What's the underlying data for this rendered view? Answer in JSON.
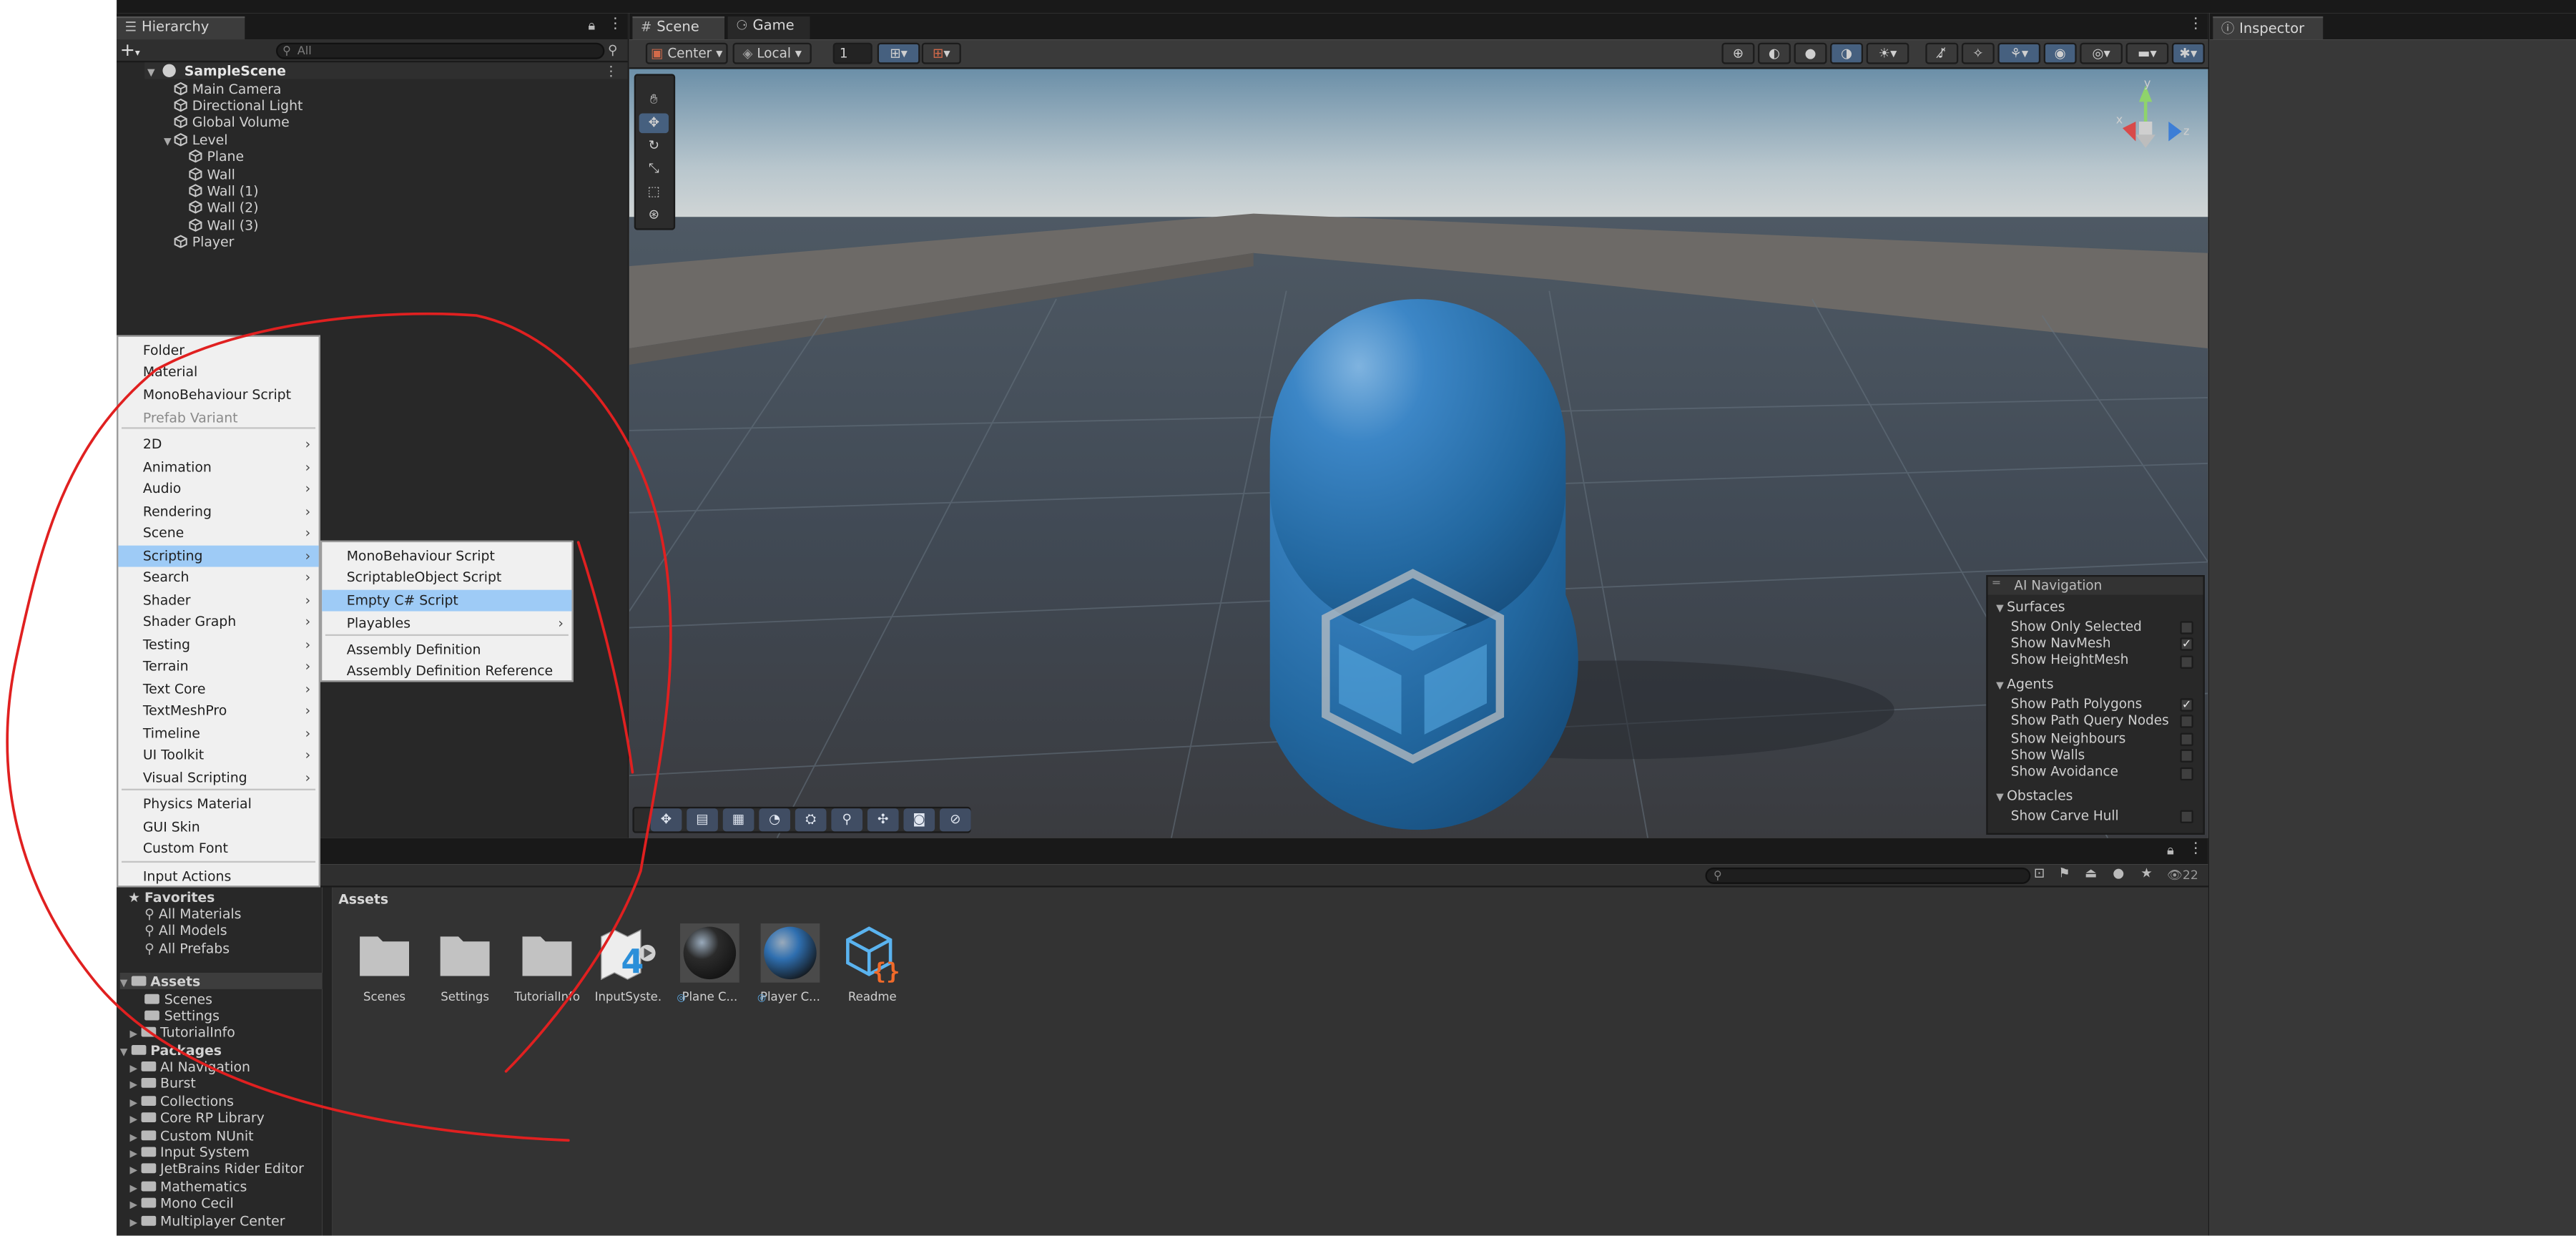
{
  "hierarchy": {
    "tab_label": "Hierarchy",
    "search_placeholder": "All",
    "scene_name": "SampleScene",
    "items": [
      "Main Camera",
      "Directional Light",
      "Global Volume",
      "Level",
      "Plane",
      "Wall",
      "Wall (1)",
      "Wall (2)",
      "Wall (3)",
      "Player"
    ]
  },
  "scene_tabs": {
    "scene": "Scene",
    "game": "Game"
  },
  "scene_toolbar": {
    "pivot": "Center",
    "space": "Local",
    "grid_value": "1"
  },
  "inspector": {
    "tab_label": "Inspector"
  },
  "gizmo_axes": {
    "y": "y",
    "x": "x",
    "z": "z"
  },
  "create_menu": {
    "items": [
      {
        "label": "Folder"
      },
      {
        "label": "Material"
      },
      {
        "label": "MonoBehaviour Script"
      },
      {
        "label": "Prefab Variant",
        "disabled": true
      },
      {
        "label": "2D",
        "submenu": true
      },
      {
        "label": "Animation",
        "submenu": true
      },
      {
        "label": "Audio",
        "submenu": true
      },
      {
        "label": "Rendering",
        "submenu": true
      },
      {
        "label": "Scene",
        "submenu": true
      },
      {
        "label": "Scripting",
        "submenu": true,
        "highlighted": true
      },
      {
        "label": "Search",
        "submenu": true
      },
      {
        "label": "Shader",
        "submenu": true
      },
      {
        "label": "Shader Graph",
        "submenu": true
      },
      {
        "label": "Testing",
        "submenu": true
      },
      {
        "label": "Terrain",
        "submenu": true
      },
      {
        "label": "Text Core",
        "submenu": true
      },
      {
        "label": "TextMeshPro",
        "submenu": true
      },
      {
        "label": "Timeline",
        "submenu": true
      },
      {
        "label": "UI Toolkit",
        "submenu": true
      },
      {
        "label": "Visual Scripting",
        "submenu": true
      },
      {
        "label": "Physics Material"
      },
      {
        "label": "GUI Skin"
      },
      {
        "label": "Custom Font"
      },
      {
        "label": "Input Actions"
      }
    ]
  },
  "scripting_submenu": {
    "items": [
      {
        "label": "MonoBehaviour Script"
      },
      {
        "label": "ScriptableObject Script"
      },
      {
        "label": "Empty C# Script",
        "highlighted": true
      },
      {
        "label": "Playables",
        "submenu": true
      },
      {
        "label": "Assembly Definition"
      },
      {
        "label": "Assembly Definition Reference"
      }
    ]
  },
  "ai_navigation": {
    "title": "AI Navigation",
    "sections": [
      {
        "name": "Surfaces",
        "options": [
          {
            "label": "Show Only Selected",
            "checked": false
          },
          {
            "label": "Show NavMesh",
            "checked": true
          },
          {
            "label": "Show HeightMesh",
            "checked": false
          }
        ]
      },
      {
        "name": "Agents",
        "options": [
          {
            "label": "Show Path Polygons",
            "checked": true
          },
          {
            "label": "Show Path Query Nodes",
            "checked": false
          },
          {
            "label": "Show Neighbours",
            "checked": false
          },
          {
            "label": "Show Walls",
            "checked": false
          },
          {
            "label": "Show Avoidance",
            "checked": false
          }
        ]
      },
      {
        "name": "Obstacles",
        "options": [
          {
            "label": "Show Carve Hull",
            "checked": false
          }
        ]
      }
    ]
  },
  "project": {
    "favorites_label": "Favorites",
    "favorites": [
      "All Materials",
      "All Models",
      "All Prefabs"
    ],
    "assets_label": "Assets",
    "asset_folders": [
      "Scenes",
      "Settings",
      "TutorialInfo"
    ],
    "packages_label": "Packages",
    "packages": [
      "AI Navigation",
      "Burst",
      "Collections",
      "Core RP Library",
      "Custom NUnit",
      "Input System",
      "JetBrains Rider Editor",
      "Mathematics",
      "Mono Cecil",
      "Multiplayer Center"
    ],
    "breadcrumb": "Assets",
    "hidden_count": "22",
    "assets": [
      {
        "label": "Scenes",
        "icon": "folder-icon"
      },
      {
        "label": "Settings",
        "icon": "folder-icon"
      },
      {
        "label": "TutorialInfo",
        "icon": "folder-icon"
      },
      {
        "label": "InputSyste...",
        "icon": "input-actions-icon"
      },
      {
        "label": "Plane C...",
        "icon": "material-icon"
      },
      {
        "label": "Player C...",
        "icon": "material-icon"
      },
      {
        "label": "Readme",
        "icon": "readme-icon"
      }
    ]
  },
  "colors": {
    "menu_highlight": "#9ecbf6",
    "annotation_stroke": "#e02020",
    "player_capsule": "#2f78b9"
  }
}
